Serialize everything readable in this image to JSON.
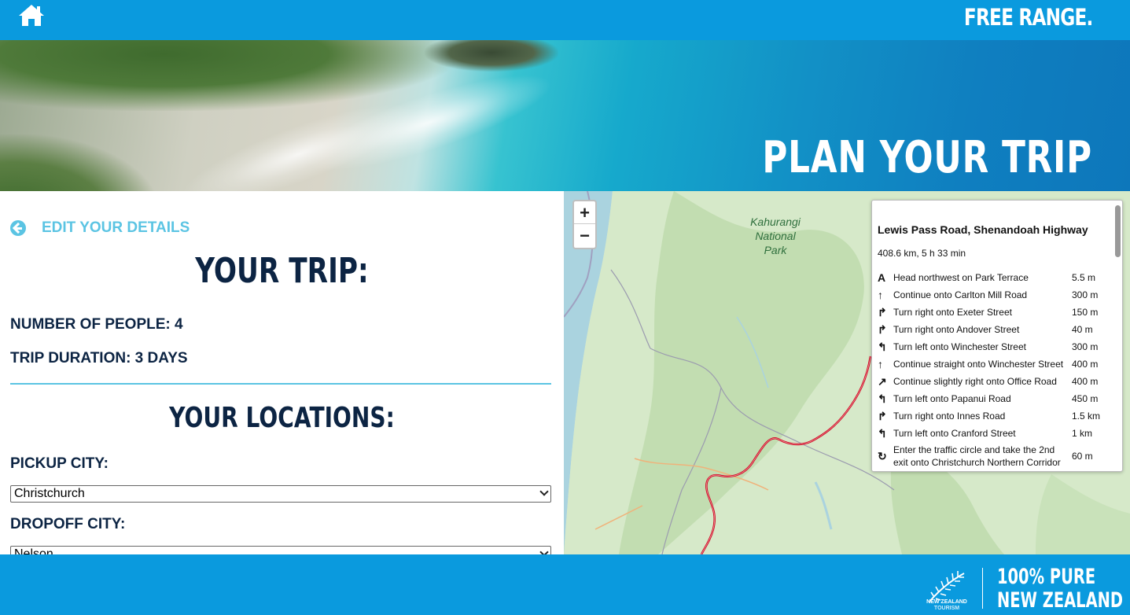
{
  "header": {
    "brand": "FREE RANGE.",
    "home_icon": "home-icon"
  },
  "hero": {
    "title": "PLAN YOUR TRIP"
  },
  "trip": {
    "edit_label": "EDIT YOUR DETAILS",
    "title": "YOUR TRIP:",
    "people": "NUMBER OF PEOPLE: 4",
    "duration": "TRIP DURATION: 3 DAYS",
    "locations_title": "YOUR LOCATIONS:",
    "pickup_label": "PICKUP CITY:",
    "pickup_value": "Christchurch",
    "dropoff_label": "DROPOFF CITY:",
    "dropoff_value": "Nelson"
  },
  "map": {
    "zoom_in": "+",
    "zoom_out": "−",
    "park_label": "Kahurangi National Park",
    "route": {
      "name": "Lewis Pass Road, Shenandoah Highway",
      "summary": "408.6 km, 5 h 33 min",
      "steps": [
        {
          "icon": "A",
          "text": "Head northwest on Park Terrace",
          "dist": "5.5 m"
        },
        {
          "icon": "↑",
          "text": "Continue onto Carlton Mill Road",
          "dist": "300 m"
        },
        {
          "icon": "↱",
          "text": "Turn right onto Exeter Street",
          "dist": "150 m"
        },
        {
          "icon": "↱",
          "text": "Turn right onto Andover Street",
          "dist": "40 m"
        },
        {
          "icon": "↰",
          "text": "Turn left onto Winchester Street",
          "dist": "300 m"
        },
        {
          "icon": "↑",
          "text": "Continue straight onto Winchester Street",
          "dist": "400 m"
        },
        {
          "icon": "↗",
          "text": "Continue slightly right onto Office Road",
          "dist": "400 m"
        },
        {
          "icon": "↰",
          "text": "Turn left onto Papanui Road",
          "dist": "450 m"
        },
        {
          "icon": "↱",
          "text": "Turn right onto Innes Road",
          "dist": "1.5 km"
        },
        {
          "icon": "↰",
          "text": "Turn left onto Cranford Street",
          "dist": "1 km"
        },
        {
          "icon": "↻",
          "text": "Enter the traffic circle and take the 2nd exit onto Christchurch Northern Corridor",
          "dist": "60 m"
        }
      ]
    }
  },
  "footer": {
    "logo_small": "NEW ZEALAND",
    "logo_tourism": "TOURISM",
    "pure_line1": "100% PURE",
    "pure_line2": "NEW ZEALAND"
  },
  "colors": {
    "bar_blue": "#0a9ade",
    "navy": "#0c2443",
    "accent_light_blue": "#5bc4e3",
    "route_red": "#d0021b"
  }
}
